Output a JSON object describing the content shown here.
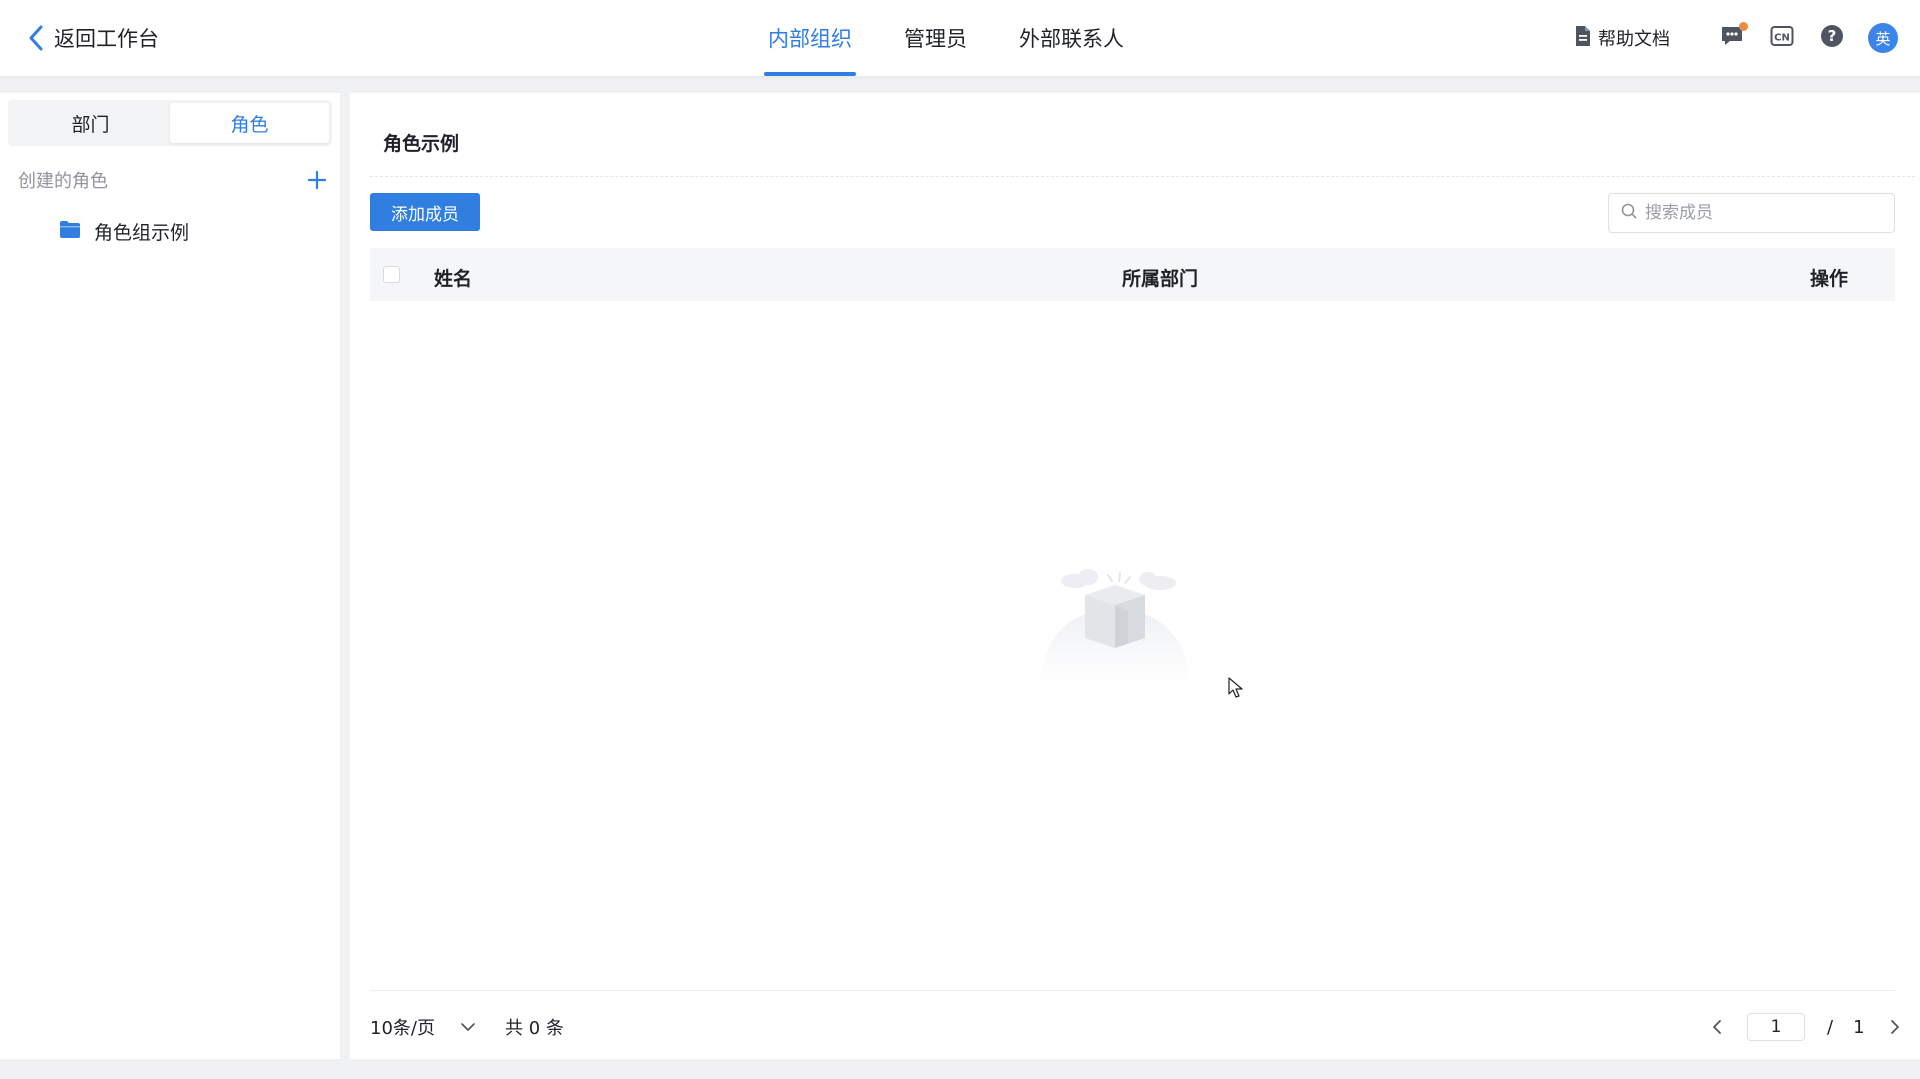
{
  "header": {
    "back_label": "返回工作台",
    "tabs": [
      {
        "label": "内部组织",
        "active": true
      },
      {
        "label": "管理员",
        "active": false
      },
      {
        "label": "外部联系人",
        "active": false
      }
    ],
    "help_doc_label": "帮助文档",
    "avatar_text": "英",
    "lang_icon_text": "CN",
    "help_icon_text": "?",
    "accent_color": "#2f7ee0",
    "notification_dot_color": "#f08a3c"
  },
  "sidebar": {
    "segments": [
      {
        "label": "部门",
        "active": false
      },
      {
        "label": "角色",
        "active": true
      }
    ],
    "group_title": "创建的角色",
    "items": [
      {
        "label": "角色组示例",
        "icon": "folder-icon"
      }
    ]
  },
  "main": {
    "title": "角色示例",
    "add_button_label": "添加成员",
    "search_placeholder": "搜索成员",
    "columns": [
      "姓名",
      "所属部门",
      "操作"
    ],
    "rows": []
  },
  "pagination": {
    "page_size_label": "10条/页",
    "total_label": "共 0 条",
    "current_page": "1",
    "separator": "/",
    "total_pages": "1"
  }
}
